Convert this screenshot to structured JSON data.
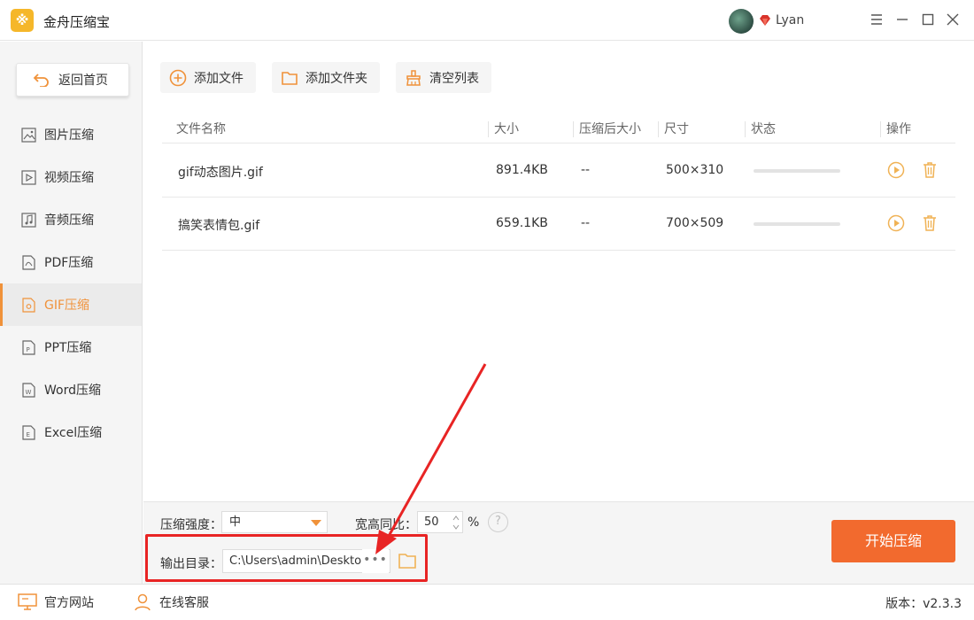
{
  "app": {
    "title": "金舟压缩宝",
    "logo_glyph": "※"
  },
  "user": {
    "name": "Lyan"
  },
  "sidebar": {
    "back_label": "返回首页",
    "items": [
      {
        "label": "图片压缩",
        "icon": "image-icon",
        "active": false
      },
      {
        "label": "视频压缩",
        "icon": "video-icon",
        "active": false
      },
      {
        "label": "音频压缩",
        "icon": "audio-icon",
        "active": false
      },
      {
        "label": "PDF压缩",
        "icon": "pdf-icon",
        "active": false
      },
      {
        "label": "GIF压缩",
        "icon": "gif-icon",
        "active": true
      },
      {
        "label": "PPT压缩",
        "icon": "ppt-icon",
        "active": false
      },
      {
        "label": "Word压缩",
        "icon": "word-icon",
        "active": false
      },
      {
        "label": "Excel压缩",
        "icon": "excel-icon",
        "active": false
      }
    ]
  },
  "toolbar": {
    "add_file": "添加文件",
    "add_folder": "添加文件夹",
    "clear_list": "清空列表"
  },
  "table": {
    "headers": [
      "文件名称",
      "大小",
      "压缩后大小",
      "尺寸",
      "状态",
      "操作"
    ],
    "rows": [
      {
        "name": "gif动态图片.gif",
        "size": "891.4KB",
        "compressed": "--",
        "dimensions": "500×310",
        "progress": 0
      },
      {
        "name": "搞笑表情包.gif",
        "size": "659.1KB",
        "compressed": "--",
        "dimensions": "700×509",
        "progress": 0
      }
    ]
  },
  "settings": {
    "strength_label": "压缩强度：",
    "strength_value": "中",
    "ratio_label": "宽高同比：",
    "ratio_value": "50",
    "ratio_unit": "%",
    "help_glyph": "?",
    "output_label": "输出目录：",
    "output_path": "C:\\Users\\admin\\Desktop\\",
    "browse_dots": "•••"
  },
  "start_button": "开始压缩",
  "footer": {
    "website": "官方网站",
    "support": "在线客服",
    "version_label": "版本：",
    "version": "v2.3.3"
  },
  "colors": {
    "accent": "#f0923a",
    "start": "#f26a2e",
    "highlight": "#e82424",
    "logo": "#f5b72a"
  }
}
